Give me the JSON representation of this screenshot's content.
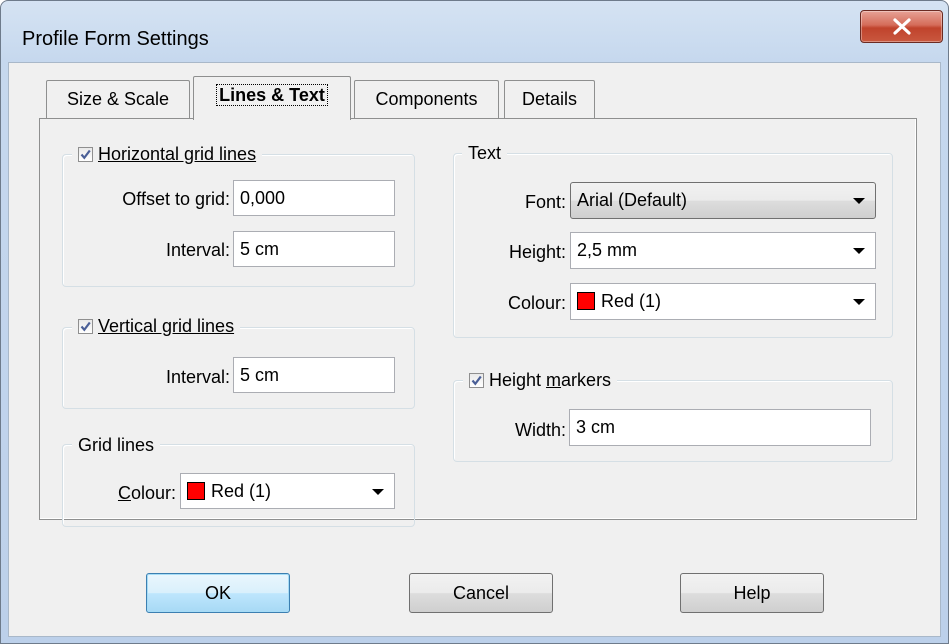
{
  "window": {
    "title": "Profile Form Settings"
  },
  "tabs": [
    {
      "label": "Size & Scale"
    },
    {
      "label": "Lines & Text"
    },
    {
      "label": "Components"
    },
    {
      "label": "Details"
    }
  ],
  "horizontal_grid": {
    "label": "Horizontal grid lines",
    "checked": true,
    "offset_label": "Offset to grid:",
    "offset_value": "0,000",
    "interval_label": "Interval:",
    "interval_value": "5 cm"
  },
  "vertical_grid": {
    "label": "Vertical grid lines",
    "checked": true,
    "interval_label": "Interval:",
    "interval_value": "5 cm"
  },
  "grid_lines": {
    "title": "Grid lines",
    "colour_label": "Colour:",
    "colour_value": "Red (1)",
    "colour_hex": "#ff0000"
  },
  "text": {
    "title": "Text",
    "font_label": "Font:",
    "font_value": "Arial (Default)",
    "height_label": "Height:",
    "height_value": "2,5 mm",
    "colour_label": "Colour:",
    "colour_value": "Red (1)",
    "colour_hex": "#ff0000"
  },
  "height_markers": {
    "label": "Height markers",
    "checked": true,
    "width_label": "Width:",
    "width_value": "3 cm"
  },
  "buttons": {
    "ok": "OK",
    "cancel": "Cancel",
    "help": "Help"
  }
}
